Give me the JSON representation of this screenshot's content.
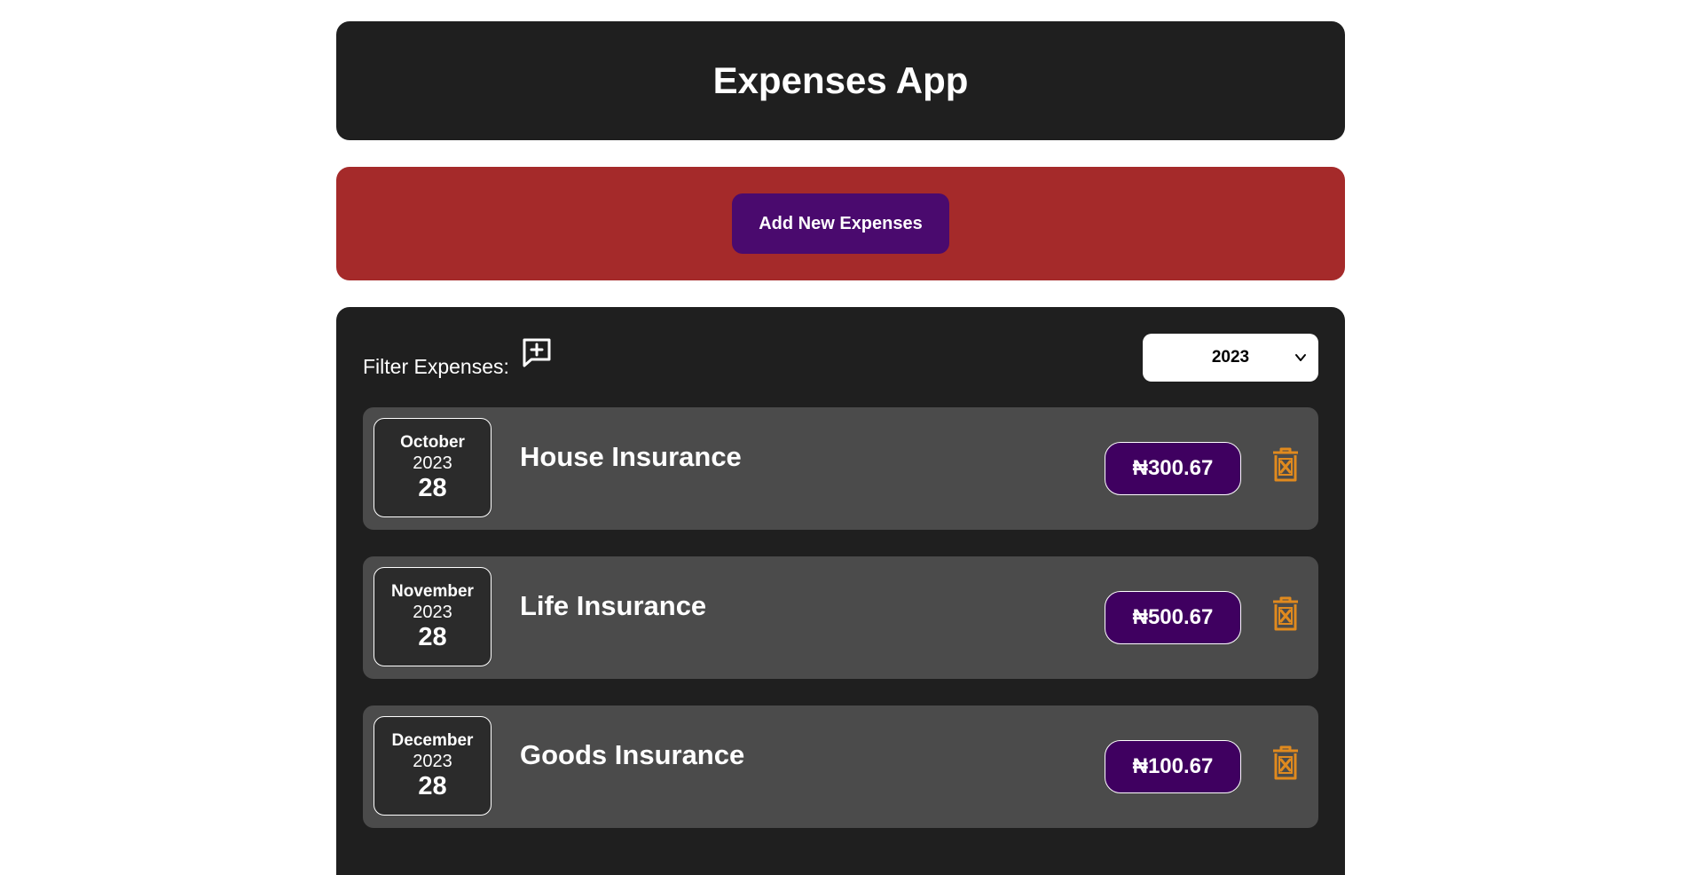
{
  "app": {
    "title": "Expenses App"
  },
  "add_panel": {
    "button_label": "Add New Expenses"
  },
  "filter": {
    "label": "Filter Expenses:",
    "icon": "add-comment-icon",
    "selected_year": "2023"
  },
  "expenses": [
    {
      "month": "October",
      "year": "2023",
      "day": "28",
      "title": "House Insurance",
      "amount": "₦300.67"
    },
    {
      "month": "November",
      "year": "2023",
      "day": "28",
      "title": "Life Insurance",
      "amount": "₦500.67"
    },
    {
      "month": "December",
      "year": "2023",
      "day": "28",
      "title": "Goods Insurance",
      "amount": "₦100.67"
    }
  ],
  "colors": {
    "header_bg": "#1f1f1f",
    "add_panel_bg": "#a52a2a",
    "button_bg": "#4a0a6e",
    "item_bg": "#4b4b4b",
    "price_bg": "#3f0060",
    "delete_icon": "#e08a1e"
  }
}
